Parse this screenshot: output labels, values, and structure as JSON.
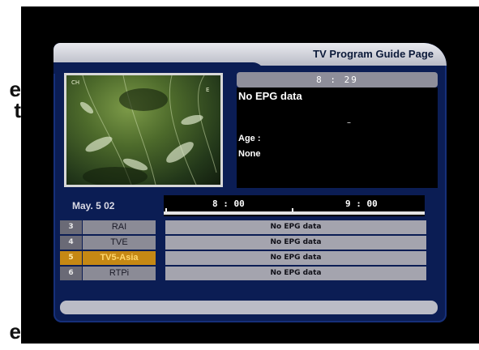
{
  "edge_chars": [
    "e",
    "t",
    "e"
  ],
  "header": {
    "title": "TV Program Guide Page"
  },
  "preview": {
    "corner_label": "CH",
    "corner_mark": "E"
  },
  "current_time": "8 : 29",
  "epg_info": {
    "status": "No EPG data",
    "dash": "–",
    "age_label": "Age :",
    "age_value": "None"
  },
  "date": "May. 5  02",
  "timeline": {
    "start": "8 : 00",
    "end": "9 : 00"
  },
  "channels": [
    {
      "number": "3",
      "name": "RAI",
      "epg": "No EPG data",
      "selected": false
    },
    {
      "number": "4",
      "name": "TVE",
      "epg": "No EPG data",
      "selected": false
    },
    {
      "number": "5",
      "name": "TV5-Asia",
      "epg": "No EPG data",
      "selected": true
    },
    {
      "number": "6",
      "name": "RTPi",
      "epg": "No EPG data",
      "selected": false
    }
  ],
  "colors": {
    "panel": "#0b1d54",
    "header": "#c8c9d2",
    "selected": "#c58814",
    "row": "#a4a4ae"
  }
}
